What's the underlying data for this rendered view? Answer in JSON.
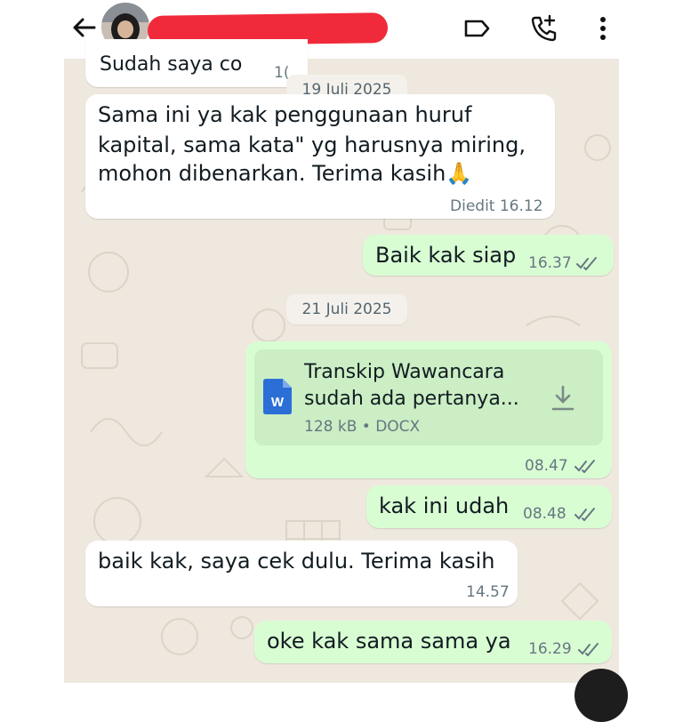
{
  "header": {
    "back_icon": "arrow-left-icon",
    "avatar": "contact-avatar",
    "contact_name_redacted": true,
    "actions": [
      "label-icon",
      "add-call-icon",
      "more-vert-icon"
    ]
  },
  "dates": [
    "19 Juli 2025",
    "21 Juli 2025"
  ],
  "messages": {
    "m0": {
      "text": "Sudah saya co",
      "time": "1("
    },
    "m1": {
      "lines": [
        "Sama ini ya kak penggunaan huruf",
        "kapital, sama kata\" yg harusnya miring,",
        "mohon dibenarkan. Terima kasih🙏"
      ],
      "time": "Diedit 16.12"
    },
    "m2": {
      "text": "Baik kak siap",
      "time": "16.37"
    },
    "m3": {
      "doc_title_lines": [
        "Transkip Wawancara",
        "sudah ada pertanya..."
      ],
      "doc_meta": "128 kB • DOCX",
      "doc_icon": "W",
      "time": "08.47"
    },
    "m4": {
      "text": "kak ini udah",
      "time": "08.48"
    },
    "m5": {
      "text": "baik kak, saya cek dulu. Terima kasih",
      "time": "14.57"
    },
    "m6": {
      "text": "oke kak sama sama ya",
      "time": "16.29"
    }
  },
  "colors": {
    "chat_bg": "#efe8df",
    "outgoing": "#d9fdd3",
    "incoming": "#ffffff",
    "read_ticks": "#667781",
    "redaction": "#f02a3a"
  }
}
